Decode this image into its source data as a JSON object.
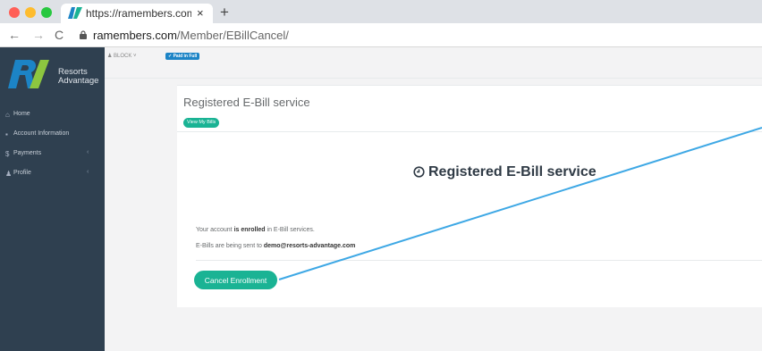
{
  "browser": {
    "tab_title": "https://ramembers.com/Memb",
    "tab_close": "×",
    "new_tab": "+",
    "back": "←",
    "forward": "→",
    "reload": "C",
    "url_domain": "ramembers.com",
    "url_path": "/Member/EBillCancel/",
    "tab_icon": "ra-favicon",
    "lock_icon": "lock-icon"
  },
  "logo": {
    "line1": "Resorts",
    "line2": "Advantage"
  },
  "sidebar": {
    "items": [
      {
        "icon": "⌂",
        "label": "Home",
        "arrow": ""
      },
      {
        "icon": "▪",
        "label": "Account Information",
        "arrow": ""
      },
      {
        "icon": "$",
        "label": "Payments",
        "arrow": "‹"
      },
      {
        "icon": "♟",
        "label": "Profile",
        "arrow": "‹"
      }
    ]
  },
  "topbar": {
    "user": "BLOCK ˅",
    "paid_badge": "Paid in Full"
  },
  "panel": {
    "title": "Registered E-Bill service",
    "view_bills": "View My Bills",
    "heading": "Registered E-Bill service",
    "line1_pre": "Your account ",
    "line1_bold": "is enrolled",
    "line1_post": " in E-Bill services.",
    "line2_pre": "E-Bills are being sent to ",
    "line2_bold": "demo@resorts-advantage.com",
    "cancel": "Cancel Enrollment"
  },
  "colors": {
    "sidebar_bg": "#2f4050",
    "accent_green": "#1ab394",
    "badge_blue": "#1c84c6",
    "annotation_line": "#3ea8e5"
  }
}
